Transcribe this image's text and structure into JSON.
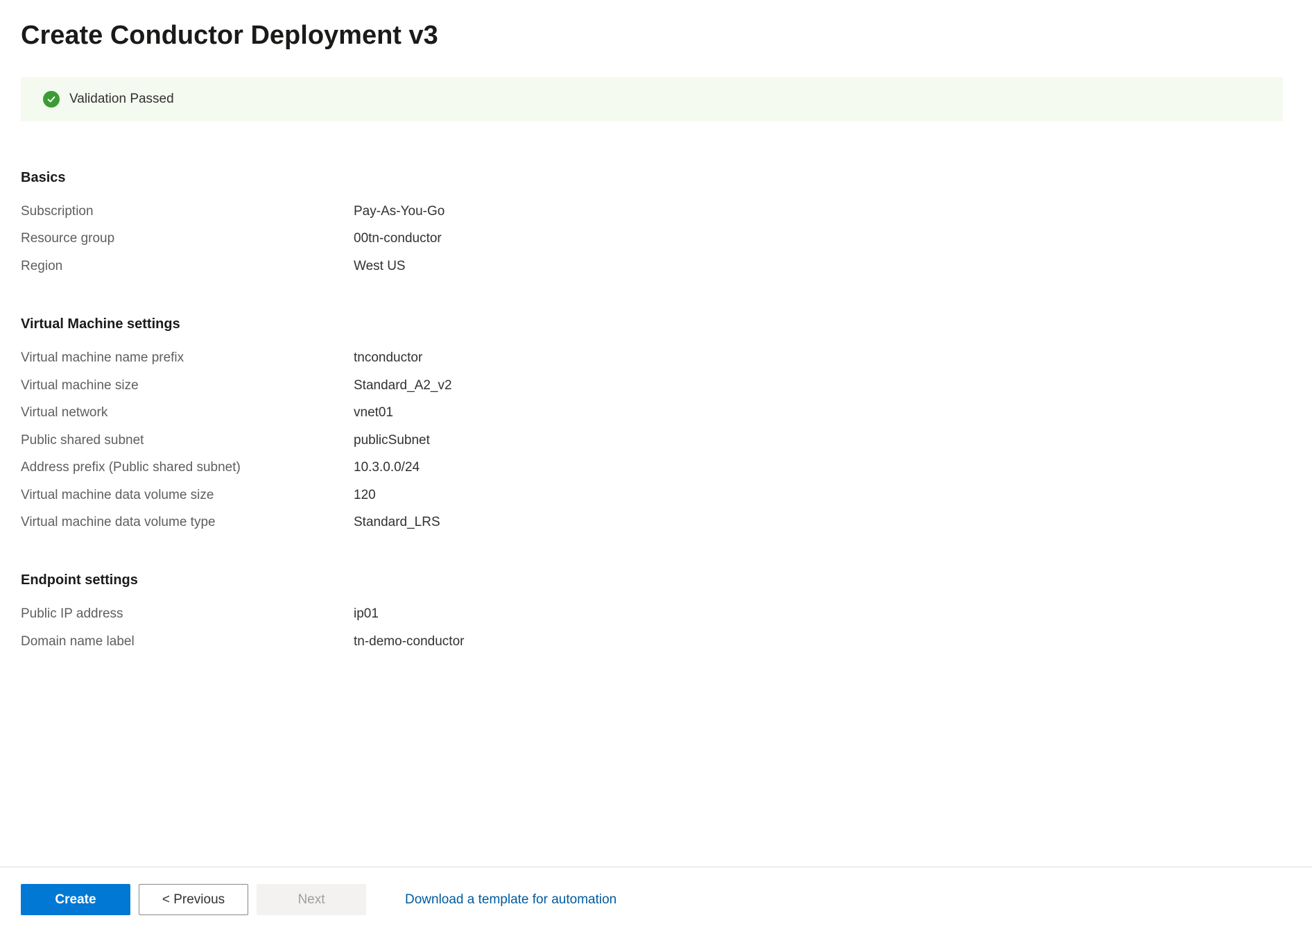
{
  "page": {
    "title": "Create Conductor Deployment v3"
  },
  "validation": {
    "message": "Validation Passed"
  },
  "sections": {
    "basics": {
      "heading": "Basics",
      "subscription": {
        "label": "Subscription",
        "value": "Pay-As-You-Go"
      },
      "resourceGroup": {
        "label": "Resource group",
        "value": "00tn-conductor"
      },
      "region": {
        "label": "Region",
        "value": "West US"
      }
    },
    "vm": {
      "heading": "Virtual Machine settings",
      "vmNamePrefix": {
        "label": "Virtual machine name prefix",
        "value": "tnconductor"
      },
      "vmSize": {
        "label": "Virtual machine size",
        "value": "Standard_A2_v2"
      },
      "vnet": {
        "label": "Virtual network",
        "value": "vnet01"
      },
      "publicSubnet": {
        "label": "Public shared subnet",
        "value": "publicSubnet"
      },
      "addressPrefix": {
        "label": "Address prefix (Public shared subnet)",
        "value": "10.3.0.0/24"
      },
      "dataVolumeSize": {
        "label": "Virtual machine data volume size",
        "value": "120"
      },
      "dataVolumeType": {
        "label": "Virtual machine data volume type",
        "value": "Standard_LRS"
      }
    },
    "endpoint": {
      "heading": "Endpoint settings",
      "publicIp": {
        "label": "Public IP address",
        "value": "ip01"
      },
      "domainLabel": {
        "label": "Domain name label",
        "value": "tn-demo-conductor"
      }
    }
  },
  "footer": {
    "create": "Create",
    "previous": "< Previous",
    "next": "Next",
    "downloadLink": "Download a template for automation"
  }
}
